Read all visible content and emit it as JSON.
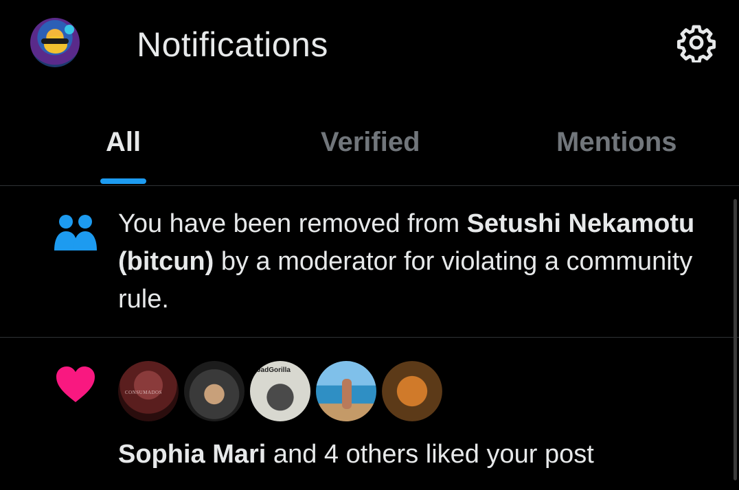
{
  "header": {
    "title": "Notifications",
    "avatar_icon": "user-avatar",
    "settings_icon": "gear-icon"
  },
  "tabs": [
    {
      "label": "All",
      "active": true
    },
    {
      "label": "Verified",
      "active": false
    },
    {
      "label": "Mentions",
      "active": false
    }
  ],
  "notifications": [
    {
      "icon": "community-icon",
      "text_prefix": "You have been removed from ",
      "community_name": "Setushi Nekamotu (bitcun)",
      "text_suffix": " by a moderator for violating a community rule."
    },
    {
      "icon": "heart-icon",
      "liker_avatar_texts": [
        "CONSUMADOS",
        "JadGorilla"
      ],
      "actor": "Sophia Mari",
      "action_text": " and 4 others liked your post"
    }
  ],
  "colors": {
    "background": "#000000",
    "accent": "#1d9bf0",
    "like": "#f91880",
    "text_primary": "#e7e9ea",
    "text_secondary": "#71767b",
    "divider": "#2f3336"
  }
}
